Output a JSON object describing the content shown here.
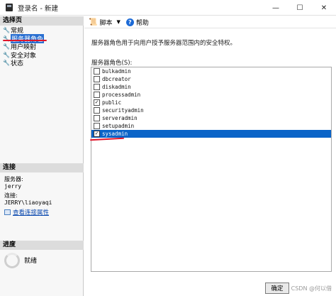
{
  "window": {
    "title": "登录名 - 新建",
    "minimize": "—",
    "maximize": "☐",
    "close": "✕"
  },
  "left_panel": {
    "select_page_header": "选择页",
    "pages": [
      {
        "label": "常规",
        "selected": false
      },
      {
        "label": "服务器角色",
        "selected": true
      },
      {
        "label": "用户映射",
        "selected": false
      },
      {
        "label": "安全对象",
        "selected": false
      },
      {
        "label": "状态",
        "selected": false
      }
    ],
    "connection_header": "连接",
    "server_label": "服务器:",
    "server_value": "jerry",
    "connection_label": "连接:",
    "connection_value": "JERRY\\liaoyaqi",
    "view_connection_link": "查看连接属性",
    "progress_header": "进度",
    "progress_status": "就绪"
  },
  "toolbar": {
    "script_label": "脚本",
    "help_label": "帮助"
  },
  "main": {
    "description": "服务器角色用于向用户授予服务器范围内的安全特权。",
    "list_label": "服务器角色(S):",
    "roles": [
      {
        "name": "bulkadmin",
        "checked": false,
        "selected": false
      },
      {
        "name": "dbcreator",
        "checked": false,
        "selected": false
      },
      {
        "name": "diskadmin",
        "checked": false,
        "selected": false
      },
      {
        "name": "processadmin",
        "checked": false,
        "selected": false
      },
      {
        "name": "public",
        "checked": true,
        "selected": false
      },
      {
        "name": "securityadmin",
        "checked": false,
        "selected": false
      },
      {
        "name": "serveradmin",
        "checked": false,
        "selected": false
      },
      {
        "name": "setupadmin",
        "checked": false,
        "selected": false
      },
      {
        "name": "sysadmin",
        "checked": true,
        "selected": true
      }
    ]
  },
  "footer": {
    "ok_label": "确定",
    "watermark": "CSDN @何以借"
  }
}
